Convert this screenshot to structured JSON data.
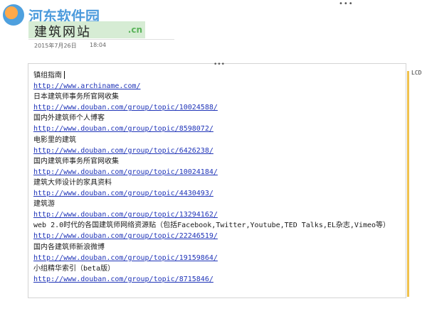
{
  "top_menu_glyph": "•••",
  "logo": {
    "site_name": "河东软件园",
    "url_overlay": ".cn"
  },
  "page": {
    "title": "建筑网站",
    "date": "2015年7月26日",
    "time": "18:04"
  },
  "box_glyph": "•••",
  "side_label": "LCD",
  "content": [
    {
      "text": "镇组指南",
      "link": false,
      "cursor": true
    },
    {
      "text": "http://www.archiname.com/",
      "link": true
    },
    {
      "text": "日本建筑师事务所官网收集",
      "link": false
    },
    {
      "text": "http://www.douban.com/group/topic/10024588/",
      "link": true
    },
    {
      "text": "国内外建筑师个人博客",
      "link": false
    },
    {
      "text": "http://www.douban.com/group/topic/8598072/",
      "link": true
    },
    {
      "text": "电影里的建筑",
      "link": false
    },
    {
      "text": "http://www.douban.com/group/topic/6426238/",
      "link": true
    },
    {
      "text": "国内建筑师事务所官网收集",
      "link": false
    },
    {
      "text": "http://www.douban.com/group/topic/10024184/",
      "link": true
    },
    {
      "text": "建筑大师设计的家具资料",
      "link": false
    },
    {
      "text": "http://www.douban.com/group/topic/4430493/",
      "link": true
    },
    {
      "text": "建筑游",
      "link": false
    },
    {
      "text": "http://www.douban.com/group/topic/13294162/",
      "link": true
    },
    {
      "text": "web 2.0时代的各国建筑师网络资源贴（包括Facebook,Twitter,Youtube,TED Talks,EL杂志,Vimeo等）",
      "link": false,
      "wrap": true
    },
    {
      "text": "http://www.douban.com/group/topic/22246519/",
      "link": true
    },
    {
      "text": "国内各建筑师新浪微博",
      "link": false
    },
    {
      "text": "http://www.douban.com/group/topic/19159864/",
      "link": true
    },
    {
      "text": "小组精华索引（beta版）",
      "link": false
    },
    {
      "text": "http://www.douban.com/group/topic/8715846/",
      "link": true
    }
  ]
}
